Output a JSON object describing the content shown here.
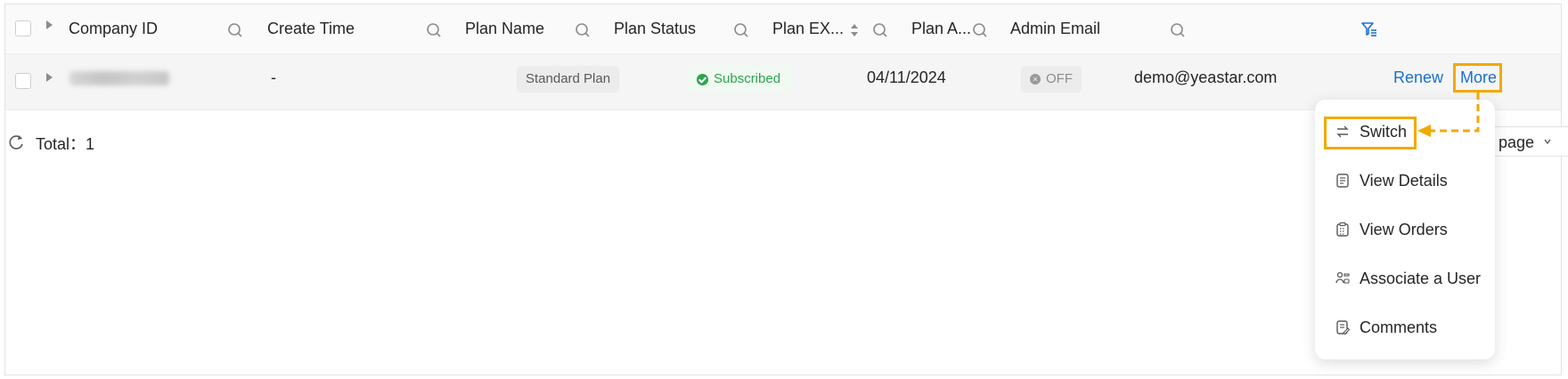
{
  "table": {
    "columns": [
      {
        "label": "Company ID"
      },
      {
        "label": "Create Time"
      },
      {
        "label": "Plan Name"
      },
      {
        "label": "Plan Status"
      },
      {
        "label": "Plan EX..."
      },
      {
        "label": "Plan A..."
      },
      {
        "label": "Admin Email"
      }
    ],
    "row": {
      "company_id": "",
      "create_time": "-",
      "plan_name": "Standard Plan",
      "plan_status": "Subscribed",
      "plan_expire": "04/11/2024",
      "plan_auto": "OFF",
      "admin_email": "demo@yeastar.com",
      "actions": {
        "renew": "Renew",
        "more": "More"
      }
    }
  },
  "footer": {
    "total_label": "Total：",
    "total_value": "1",
    "page_size_label": "page"
  },
  "more_menu": {
    "items": [
      {
        "label": "Switch",
        "icon": "switch-icon"
      },
      {
        "label": "View Details",
        "icon": "document-icon"
      },
      {
        "label": "View Orders",
        "icon": "clipboard-icon"
      },
      {
        "label": "Associate a User",
        "icon": "users-icon"
      },
      {
        "label": "Comments",
        "icon": "comment-note-icon"
      }
    ]
  },
  "colors": {
    "link": "#1a6fd6",
    "success": "#2ea44f",
    "highlight": "#f2a900",
    "filter_icon": "#1a6fd6"
  }
}
